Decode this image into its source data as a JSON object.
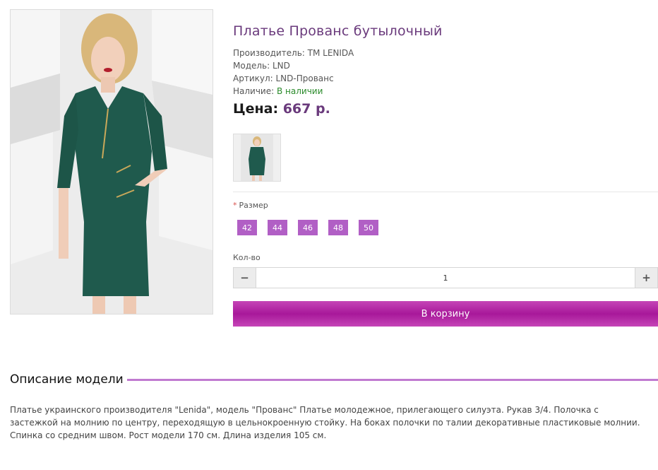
{
  "product": {
    "title": "Платье Прованс бутылочный",
    "manufacturer": "Производитель: ТМ LENIDA",
    "model": "Модель: LND",
    "sku": "Артикул: LND-Прованс",
    "availability_label": "Наличие:",
    "availability_value": "В наличии",
    "price_label": "Цена:",
    "price_value": "667 р."
  },
  "options": {
    "size_required_mark": "*",
    "size_label": "Размер",
    "sizes": [
      "42",
      "44",
      "46",
      "48",
      "50"
    ]
  },
  "quantity": {
    "label": "Кол-во",
    "minus_icon": "minus-icon",
    "plus_icon": "plus-icon",
    "value": "1"
  },
  "cart": {
    "button_label": "В корзину"
  },
  "description": {
    "title": "Описание модели",
    "text": "Платье украинского производителя \"Lenida\", модель \"Прованс\" Платье молодежное, прилегающего силуэта. Рукав 3/4. Полочка с застежкой на молнию по центру, переходящую в цельнокроенную стойку. На боках полочки по талии декоративные пластиковые молнии. Спинка со средним швом. Рост модели 170 см. Длина изделия 105 см."
  },
  "colors": {
    "accent": "#b15fc5",
    "title": "#6a3a7c",
    "in_stock": "#2a8a2a",
    "dress": "#1f5a4d"
  }
}
